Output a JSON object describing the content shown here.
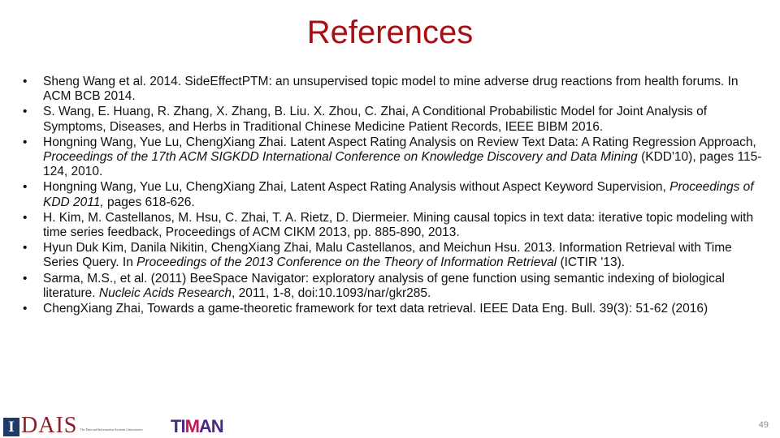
{
  "slide": {
    "title": "References",
    "page_number": "49",
    "title_color": "#a50f15"
  },
  "references": [
    {
      "bullet": "•",
      "segments": [
        {
          "text": "Sheng Wang et al.  2014. SideEffectPTM: an unsupervised topic model to mine adverse drug reactions from health forums. In ACM BCB 2014.",
          "italic": false
        }
      ]
    },
    {
      "bullet": "•",
      "segments": [
        {
          "text": "S.  Wang,  E. Huang, R. Zhang, X. Zhang, B. Liu. X. Zhou, C.  Zhai, A Conditional Probabilistic Model for Joint Analysis of Symptoms, Diseases, and Herbs in Traditional Chinese Medicine Patient Records, IEEE BIBM 2016.",
          "italic": false
        }
      ]
    },
    {
      "bullet": "•",
      "segments": [
        {
          "text": "Hongning Wang, Yue Lu, ChengXiang Zhai. Latent Aspect Rating Analysis on Review Text Data: A Rating Regression Approach, ",
          "italic": false
        },
        {
          "text": "Proceedings of the 17th ACM SIGKDD International Conference on Knowledge Discovery and Data Mining",
          "italic": true
        },
        {
          "text": " (KDD'10), pages 115-124, 2010.",
          "italic": false
        }
      ]
    },
    {
      "bullet": "•",
      "segments": [
        {
          "text": "Hongning Wang, Yue Lu, ChengXiang Zhai, Latent Aspect Rating Analysis without Aspect Keyword Supervision, ",
          "italic": false
        },
        {
          "text": "Proceedings of KDD 2011,",
          "italic": true
        },
        {
          "text": " pages 618-626.",
          "italic": false
        }
      ]
    },
    {
      "bullet": "•",
      "segments": [
        {
          "text": "H.  Kim, M. Castellanos, M. Hsu, C. Zhai, T. A. Rietz, D. Diermeier. Mining causal topics in text data: iterative topic modeling with time series feedback, Proceedings of ACM CIKM 2013, pp. 885-890, 2013.",
          "italic": false
        }
      ]
    },
    {
      "bullet": "•",
      "segments": [
        {
          "text": "Hyun Duk Kim, Danila Nikitin, ChengXiang Zhai, Malu Castellanos, and Meichun Hsu. 2013. Information Retrieval with Time Series Query. In ",
          "italic": false
        },
        {
          "text": "Proceedings of the 2013 Conference on the Theory of Information Retrieval",
          "italic": true
        },
        {
          "text": " (ICTIR '13).",
          "italic": false
        }
      ]
    },
    {
      "bullet": "•",
      "segments": [
        {
          "text": "Sarma, M.S., et al. (2011) BeeSpace Navigator: exploratory analysis of gene function using semantic indexing of biological literature. ",
          "italic": false
        },
        {
          "text": "Nucleic Acids Research",
          "italic": true
        },
        {
          "text": ", 2011, 1-8, doi:10.1093/nar/gkr285.",
          "italic": false
        }
      ]
    },
    {
      "bullet": "•",
      "segments": [
        {
          "text": "ChengXiang Zhai, Towards a game-theoretic framework for text data retrieval. IEEE Data Eng. Bull. 39(3): 51-62 (2016)",
          "italic": false
        }
      ]
    }
  ],
  "footer": {
    "illinois_logo_letter": "I",
    "dais_logo_text": "DAIS",
    "dais_logo_subtitle": "The Data and Information Systems Laboratories",
    "timan_logo_text": {
      "part1": "TI",
      "part2": "M",
      "part3": "AN"
    }
  }
}
